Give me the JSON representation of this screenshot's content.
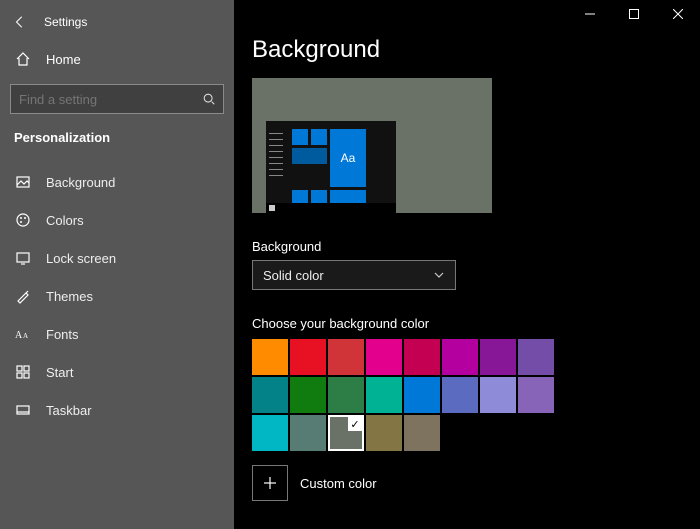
{
  "window": {
    "app_title": "Settings",
    "min_label": "Minimize",
    "max_label": "Maximize",
    "close_label": "Close"
  },
  "sidebar": {
    "back_label": "Back",
    "home_label": "Home",
    "search_placeholder": "Find a setting",
    "section_title": "Personalization",
    "items": [
      {
        "id": "background",
        "label": "Background"
      },
      {
        "id": "colors",
        "label": "Colors"
      },
      {
        "id": "lock-screen",
        "label": "Lock screen"
      },
      {
        "id": "themes",
        "label": "Themes"
      },
      {
        "id": "fonts",
        "label": "Fonts"
      },
      {
        "id": "start",
        "label": "Start"
      },
      {
        "id": "taskbar",
        "label": "Taskbar"
      }
    ]
  },
  "page": {
    "title": "Background",
    "preview_sample_text": "Aa",
    "preview_bg_color": "#6a7268",
    "dropdown": {
      "label": "Background",
      "value": "Solid color"
    },
    "swatch_section_label": "Choose your background color",
    "swatches": [
      [
        "#ff8c00",
        "#e81123",
        "#d13438",
        "#e3008c",
        "#c30052",
        "#b4009e",
        "#881798",
        "#744da9"
      ],
      [
        "#038387",
        "#107c10",
        "#2d7d46",
        "#00b294",
        "#0078d7",
        "#5b6bc0",
        "#8e8cd8",
        "#8764b8"
      ],
      [
        "#00b7c3",
        "#567c73",
        "#6a7268",
        "#847545",
        "#7d735f"
      ]
    ],
    "selected_swatch": "#6a7268",
    "custom_button_label": "Custom color"
  }
}
